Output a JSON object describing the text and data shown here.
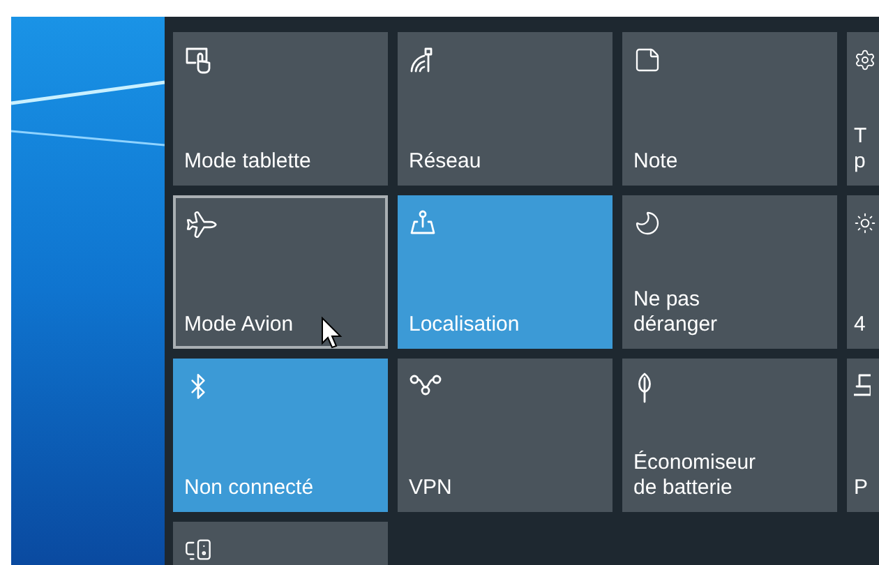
{
  "tiles": [
    {
      "label": [
        "Mode tablette"
      ],
      "on": false,
      "focused": false
    },
    {
      "label": [
        "Réseau"
      ],
      "on": false,
      "focused": false
    },
    {
      "label": [
        "Note"
      ],
      "on": false,
      "focused": false
    },
    {
      "label": [
        "T",
        "p"
      ],
      "on": false,
      "focused": false
    },
    {
      "label": [
        "Mode Avion"
      ],
      "on": false,
      "focused": true
    },
    {
      "label": [
        "Localisation"
      ],
      "on": true,
      "focused": false
    },
    {
      "label": [
        "Ne pas",
        "déranger"
      ],
      "on": false,
      "focused": false
    },
    {
      "label": [
        "4"
      ],
      "on": false,
      "focused": false
    },
    {
      "label": [
        "Non connecté"
      ],
      "on": true,
      "focused": false
    },
    {
      "label": [
        "VPN"
      ],
      "on": false,
      "focused": false
    },
    {
      "label": [
        "Économiseur",
        "de batterie"
      ],
      "on": false,
      "focused": false
    },
    {
      "label": [
        "P"
      ],
      "on": false,
      "focused": false
    },
    {
      "on": false,
      "focused": false
    }
  ]
}
